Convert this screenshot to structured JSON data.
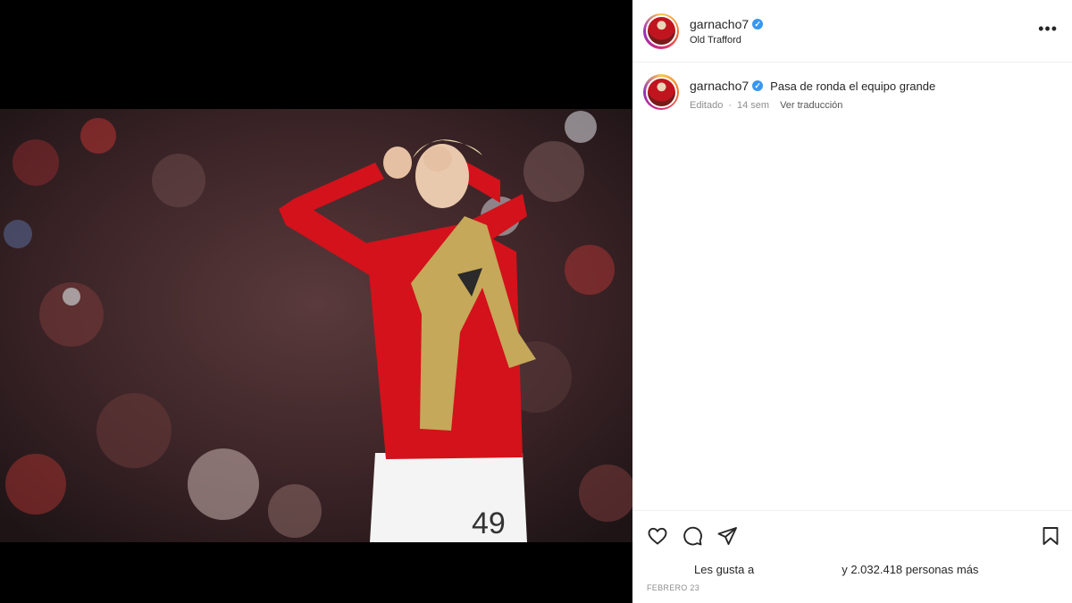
{
  "post": {
    "username": "garnacho7",
    "location": "Old Trafford",
    "caption": "Pasa de ronda el equipo grande",
    "edited": "Editado",
    "time": "14 sem",
    "translate": "Ver traducción",
    "likes_prefix": "Les gusta a",
    "likes_suffix": "y 2.032.418 personas más",
    "date": "FEBRERO 23",
    "jersey_number": "49"
  },
  "icons": {
    "more": "more-options-icon",
    "like": "heart-icon",
    "comment": "comment-icon",
    "share": "send-icon",
    "save": "bookmark-icon",
    "verified": "verified-badge-icon"
  },
  "colors": {
    "verified": "#3897f0",
    "jersey": "#d3121b",
    "muted_text": "#8e8e8e"
  }
}
